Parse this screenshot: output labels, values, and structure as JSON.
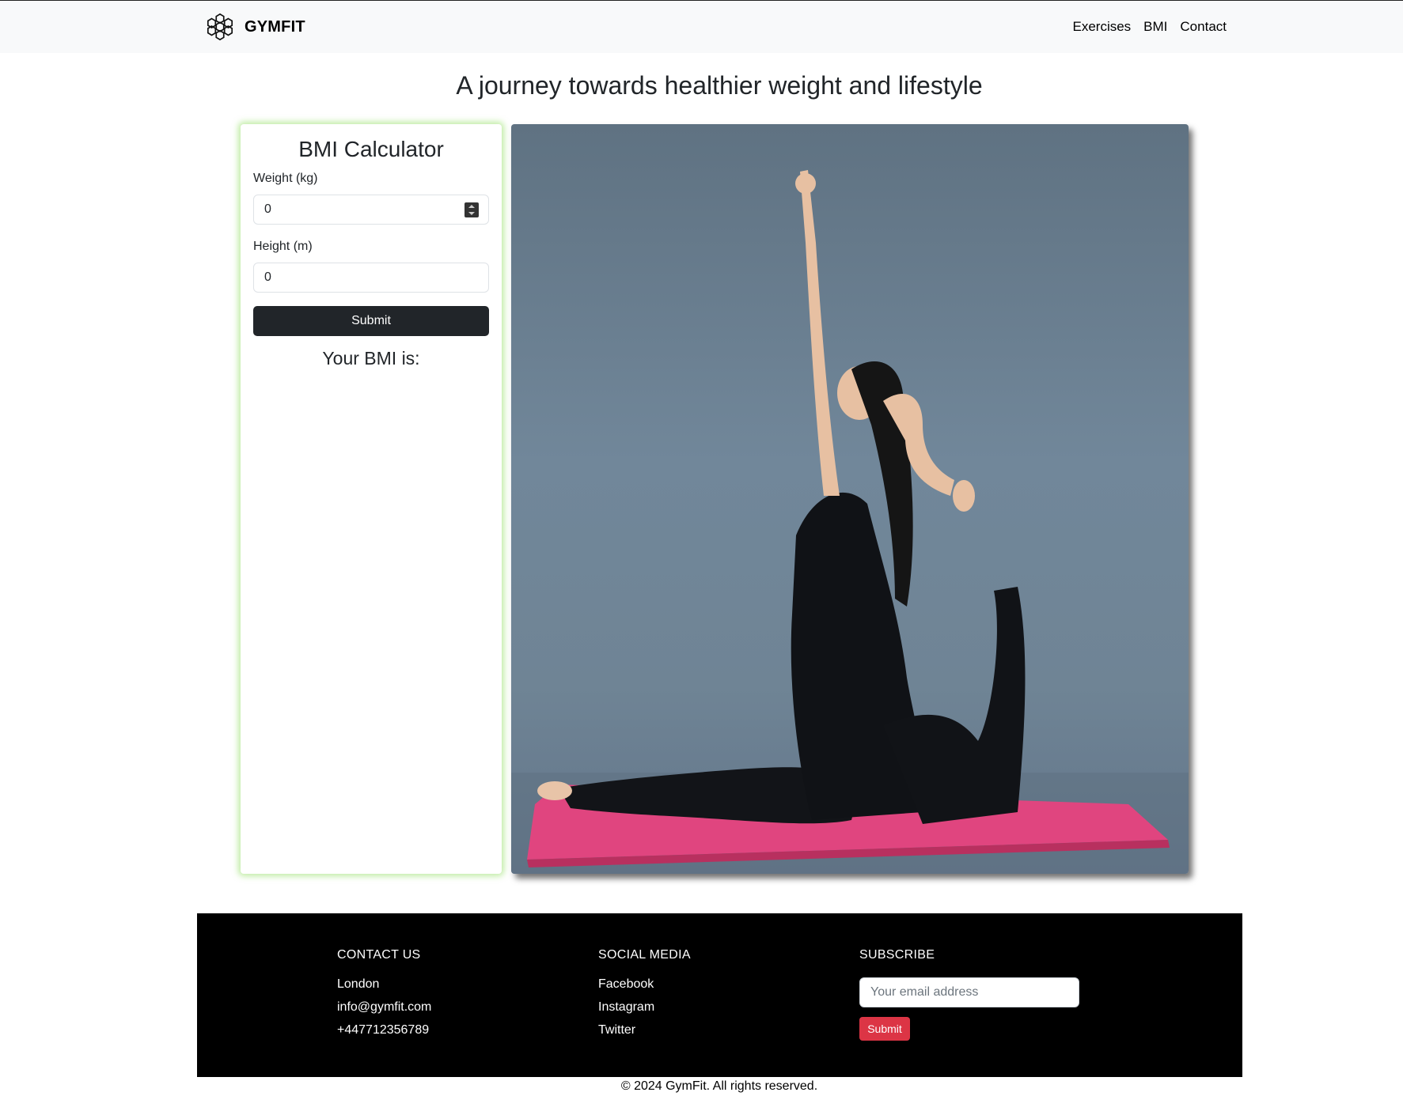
{
  "navbar": {
    "brand": "GYMFIT",
    "logo_icon": "flower-cube-logo-icon",
    "links": [
      "Exercises",
      "BMI",
      "Contact"
    ]
  },
  "hero": {
    "headline": "A journey towards healthier weight and lifestyle"
  },
  "bmi": {
    "title": "BMI Calculator",
    "weight_label": "Weight (kg)",
    "weight_value": "0",
    "height_label": "Height (m)",
    "height_value": "0",
    "submit_label": "Submit",
    "result_label": "Your BMI is:"
  },
  "photo": {
    "alt": "Woman in black outfit doing a yoga pose on a pink mat"
  },
  "footer": {
    "contact": {
      "heading": "CONTACT US",
      "items": [
        "London",
        "info@gymfit.com",
        "+447712356789"
      ]
    },
    "social": {
      "heading": "SOCIAL MEDIA",
      "items": [
        "Facebook",
        "Instagram",
        "Twitter"
      ]
    },
    "subscribe": {
      "heading": "SUBSCRIBE",
      "placeholder": "Your email address",
      "button": "Submit"
    },
    "copyright": "© 2024 GymFit. All rights reserved."
  },
  "colors": {
    "navbar_bg": "#f8f9fa",
    "card_glow": "#8cdc5a",
    "button_dark": "#212529",
    "footer_bg": "#000000",
    "subscribe_button": "#dc3545",
    "mat_pink": "#e0457f"
  }
}
